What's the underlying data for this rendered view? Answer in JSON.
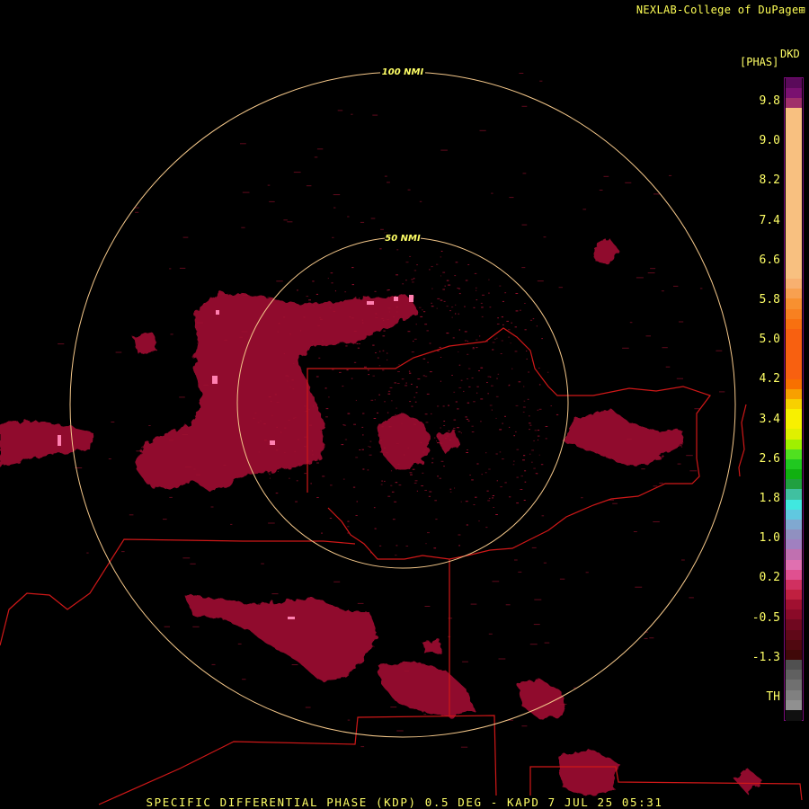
{
  "credit": "NEXLAB-College of DuPage",
  "credit_mark": "⊞",
  "product_short": "DKD",
  "unit": "[PHAS]",
  "footer": "SPECIFIC DIFFERENTIAL PHASE (KDP) 0.5 DEG - KAPD 7 JUL 25 05:31",
  "range_rings": [
    {
      "label": "50 NMI",
      "nmi": 50
    },
    {
      "label": "100 NMI",
      "nmi": 100
    }
  ],
  "colors": {
    "ring": "#f5c88a",
    "borders": "#d01818",
    "echo": "#a01030",
    "echo_dark": "#6e0a1e",
    "echo_bright": "#ff80b0"
  },
  "scale_labels": [
    "9.8",
    "9.0",
    "8.2",
    "7.4",
    "6.6",
    "5.8",
    "5.0",
    "4.2",
    "3.4",
    "2.6",
    "1.8",
    "1.0",
    "0.2",
    "-0.5",
    "-1.3",
    "TH"
  ],
  "legend_colors": [
    "#5a0a5a",
    "#7a1070",
    "#a0306a",
    "#f8c080",
    "#f8c080",
    "#f8c080",
    "#f8c080",
    "#f8c080",
    "#f8c080",
    "#f8c080",
    "#f8c080",
    "#f8c080",
    "#f8c080",
    "#f8c080",
    "#f8c080",
    "#f8c080",
    "#f8c080",
    "#f8c080",
    "#f8c080",
    "#f8c080",
    "#f8b070",
    "#f8a050",
    "#f89030",
    "#f88020",
    "#f87010",
    "#f86010",
    "#f86010",
    "#f86010",
    "#f86010",
    "#f86010",
    "#f87000",
    "#f8a000",
    "#f8d000",
    "#f8f000",
    "#f8f000",
    "#e0f000",
    "#a0f000",
    "#50e020",
    "#20c820",
    "#10b010",
    "#20a040",
    "#40c0a0",
    "#40e8e0",
    "#60c8e0",
    "#80a8d0",
    "#9090c0",
    "#a080c0",
    "#c070b0",
    "#e070b0",
    "#e05090",
    "#d03060",
    "#c02040",
    "#a01030",
    "#8a0a28",
    "#700820",
    "#600818",
    "#500810",
    "#400808",
    "#505050",
    "#606060",
    "#707070",
    "#808080",
    "#909090",
    "#101010"
  ]
}
